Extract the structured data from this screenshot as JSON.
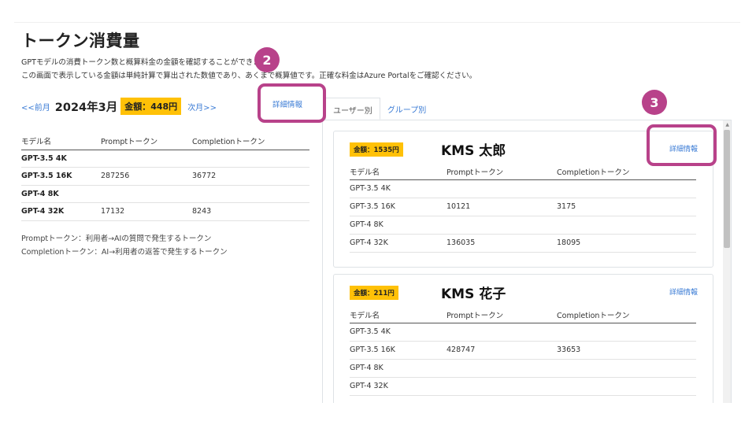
{
  "page": {
    "title": "トークン消費量",
    "description_line1": "GPTモデルの消費トークン数と概算料金の金額を確認することができます。",
    "description_line2": "この画面で表示している金額は単純計算で算出された数値であり、あくまで概算値です。正確な料金はAzure Portalをご確認ください。"
  },
  "month_nav": {
    "prev": "<<前月",
    "month": "2024年3月",
    "total": "金額：448円",
    "next": "次月>>"
  },
  "detail_tab_label": "詳細情報",
  "tabs": [
    "ユーザー別",
    "グループ別"
  ],
  "summary_table": {
    "headers": [
      "モデル名",
      "Promptトークン",
      "Completionトークン"
    ],
    "rows": [
      [
        "GPT-3.5 4K",
        "",
        ""
      ],
      [
        "GPT-3.5 16K",
        "287256",
        "36772"
      ],
      [
        "GPT-4 8K",
        "",
        ""
      ],
      [
        "GPT-4 32K",
        "17132",
        "8243"
      ]
    ]
  },
  "notes": [
    "Promptトークン：利用者→AIの質問で発生するトークン",
    "Completionトークン：AI→利用者の返答で発生するトークン"
  ],
  "users": [
    {
      "amount": "金額：1535円",
      "name": "KMS 太郎",
      "detail_link": "詳細情報",
      "headers": [
        "モデル名",
        "Promptトークン",
        "Completionトークン"
      ],
      "rows": [
        [
          "GPT-3.5 4K",
          "",
          ""
        ],
        [
          "GPT-3.5 16K",
          "10121",
          "3175"
        ],
        [
          "GPT-4 8K",
          "",
          ""
        ],
        [
          "GPT-4 32K",
          "136035",
          "18095"
        ]
      ]
    },
    {
      "amount": "金額：211円",
      "name": "KMS 花子",
      "detail_link": "詳細情報",
      "headers": [
        "モデル名",
        "Promptトークン",
        "Completionトークン"
      ],
      "rows": [
        [
          "GPT-3.5 4K",
          "",
          ""
        ],
        [
          "GPT-3.5 16K",
          "428747",
          "33653"
        ],
        [
          "GPT-4 8K",
          "",
          ""
        ],
        [
          "GPT-4 32K",
          "",
          ""
        ]
      ]
    }
  ],
  "callouts": [
    "2",
    "3"
  ],
  "colors": {
    "accent_badge": "#ffc107",
    "link": "#3a7bd5",
    "callout": "#b8428a"
  }
}
